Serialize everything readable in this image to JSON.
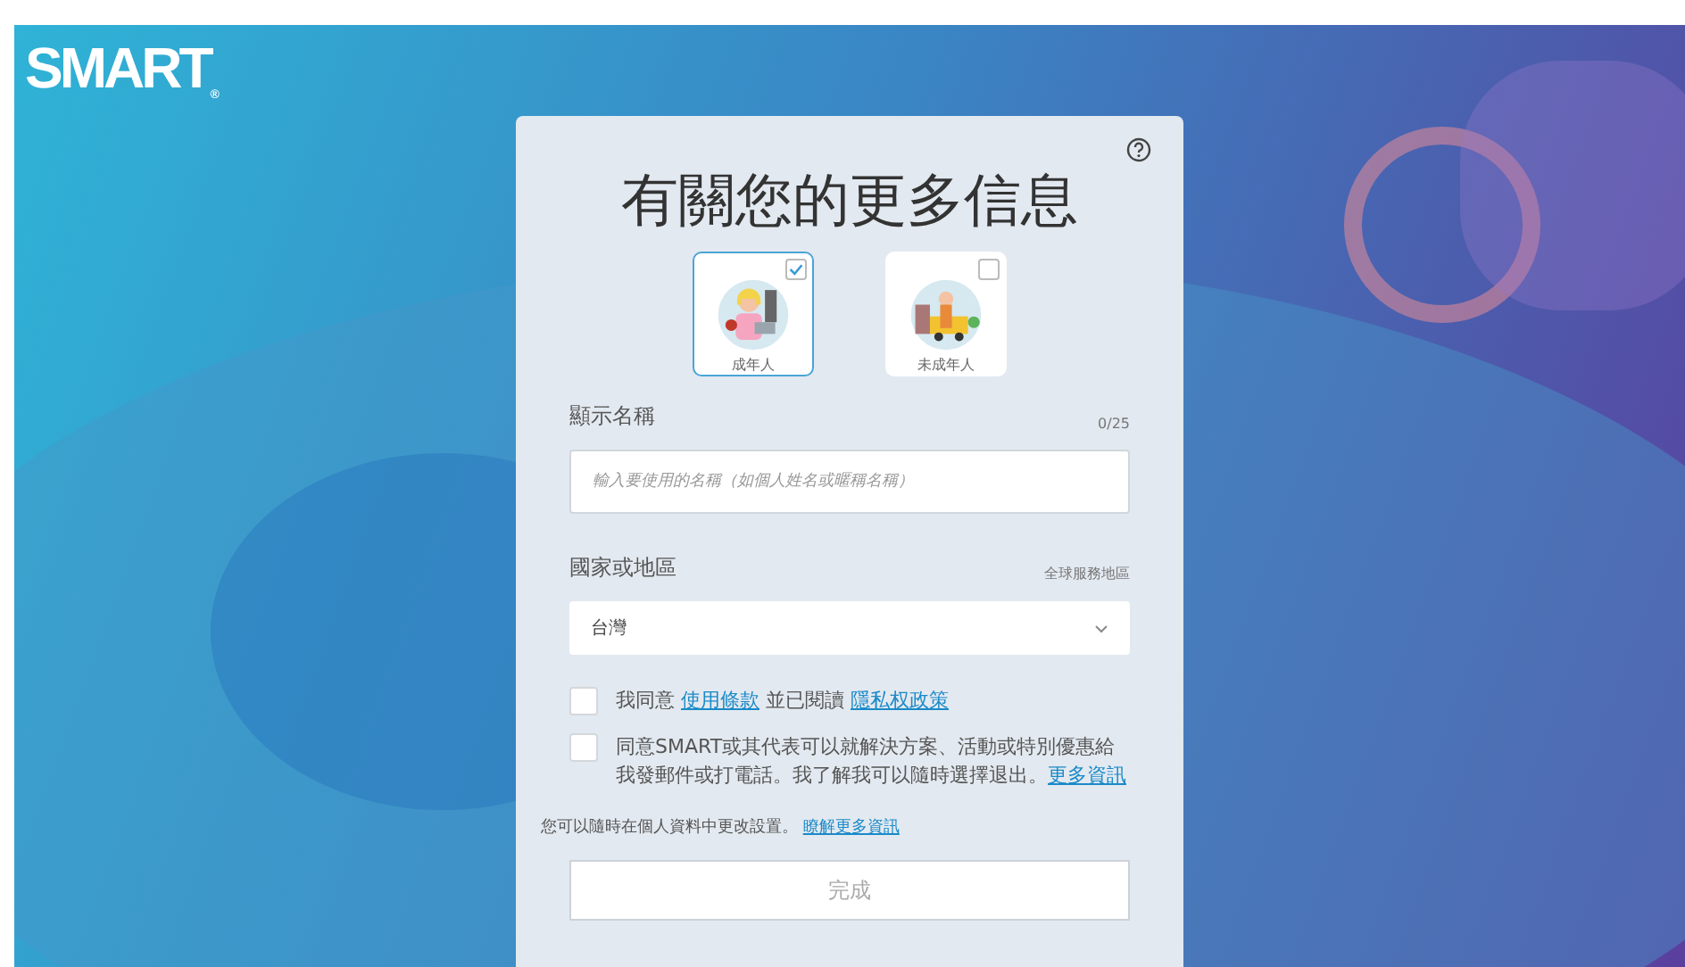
{
  "logo": {
    "text": "SMART",
    "mark": "®"
  },
  "title": "有關您的更多信息",
  "roles": [
    {
      "label": "成年人",
      "selected": true
    },
    {
      "label": "未成年人",
      "selected": false
    }
  ],
  "display_name": {
    "label": "顯示名稱",
    "counter": "0/25",
    "placeholder": "輸入要使用的名稱（如個人姓名或暱稱名稱）"
  },
  "country": {
    "label": "國家或地區",
    "hint": "全球服務地區",
    "value": "台灣"
  },
  "consents": [
    {
      "checked": false,
      "parts": [
        {
          "kind": "text",
          "text": "我同意 "
        },
        {
          "kind": "link",
          "text": "使用條款"
        },
        {
          "kind": "text",
          "text": " 並已閱讀 "
        },
        {
          "kind": "link",
          "text": "隱私权政策"
        }
      ]
    },
    {
      "checked": false,
      "parts": [
        {
          "kind": "text",
          "text": "同意SMART或其代表可以就解決方案、活動或特別優惠給我發郵件或打電話。我了解我可以隨時選擇退出。"
        },
        {
          "kind": "link",
          "text": "更多資訊"
        }
      ]
    }
  ],
  "note": {
    "text": "您可以隨時在個人資料中更改設置。 ",
    "link": "瞭解更多資訊"
  },
  "submit": "完成"
}
